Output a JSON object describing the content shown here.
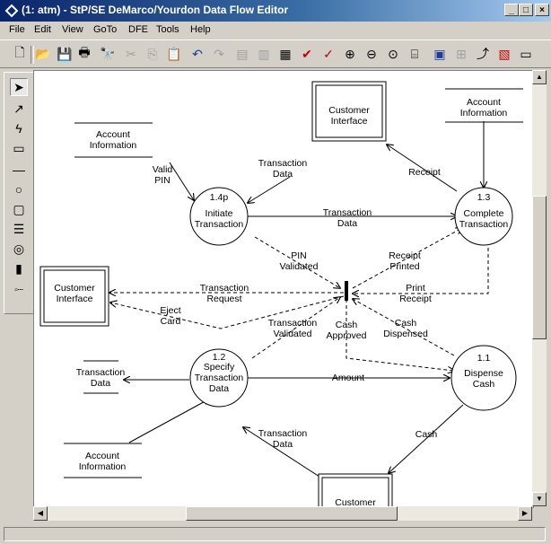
{
  "window": {
    "title": "(1: atm) - StP/SE DeMarco/Yourdon Data Flow Editor",
    "controls": {
      "minimize": "_",
      "maximize": "□",
      "close": "×"
    }
  },
  "menu": [
    "File",
    "Edit",
    "View",
    "GoTo",
    "DFE",
    "Tools",
    "Help"
  ],
  "toolbar": [
    "new-doc-icon",
    "open-folder-icon",
    "save-icon",
    "print-icon",
    "find-icon",
    "cut-icon",
    "copy-icon",
    "paste-icon",
    "undo-icon",
    "redo-icon",
    "tool-a-icon",
    "tool-b-icon",
    "tool-c-icon",
    "check-red-icon",
    "check-red2-icon",
    "zoom-in-icon",
    "zoom-out-icon",
    "zoom-fit-icon",
    "tool-d-icon",
    "tool-e-icon",
    "tool-f-icon",
    "tool-g-icon",
    "tool-h-icon",
    "tool-i-icon"
  ],
  "palette": [
    "select-arrow-icon",
    "flow-arrow-icon",
    "lightning-icon",
    "rectangle-icon",
    "line-icon",
    "circle-icon",
    "double-rect-icon",
    "store-lines-icon",
    "double-circle-icon",
    "bar-icon",
    "split-icon"
  ],
  "diagram": {
    "processes": [
      {
        "id": "1.4p",
        "name1": "Initiate",
        "name2": "Transaction"
      },
      {
        "id": "1.3",
        "name1": "Complete",
        "name2": "Transaction"
      },
      {
        "id": "1.2",
        "name1": "Specify",
        "name2": "Transaction",
        "name3": "Data"
      },
      {
        "id": "1.1",
        "name1": "Dispense",
        "name2": "Cash"
      }
    ],
    "terminators": {
      "top": {
        "l1": "Customer",
        "l2": "Interface"
      },
      "left": {
        "l1": "Customer",
        "l2": "Interface"
      },
      "bottom": {
        "l1": "Customer"
      }
    },
    "stores": {
      "acct_top_left": {
        "l1": "Account",
        "l2": "Information"
      },
      "acct_top_right": {
        "l1": "Account",
        "l2": "Information"
      },
      "txn_data": {
        "l1": "Transaction",
        "l2": "Data"
      },
      "acct_bottom": {
        "l1": "Account",
        "l2": "Information"
      }
    },
    "flows": {
      "valid_pin": {
        "l1": "Valid",
        "l2": "PIN"
      },
      "txn_data_top": {
        "l1": "Transaction",
        "l2": "Data"
      },
      "receipt": "Receipt",
      "txn_data_mid": {
        "l1": "Transaction",
        "l2": "Data"
      },
      "pin_validated": {
        "l1": "PIN",
        "l2": "Validated"
      },
      "receipt_printed": {
        "l1": "Receipt",
        "l2": "Printed"
      },
      "txn_request": {
        "l1": "Transaction",
        "l2": "Request"
      },
      "print_receipt": {
        "l1": "Print",
        "l2": "Receipt"
      },
      "eject_card": {
        "l1": "Eject",
        "l2": "Card"
      },
      "txn_validated": {
        "l1": "Transaction",
        "l2": "Validated"
      },
      "cash_approved": {
        "l1": "Cash",
        "l2": "Approved"
      },
      "cash_dispensed": {
        "l1": "Cash",
        "l2": "Dispensed"
      },
      "amount": "Amount",
      "txn_data_bottom": {
        "l1": "Transaction",
        "l2": "Data"
      },
      "cash": "Cash"
    }
  }
}
